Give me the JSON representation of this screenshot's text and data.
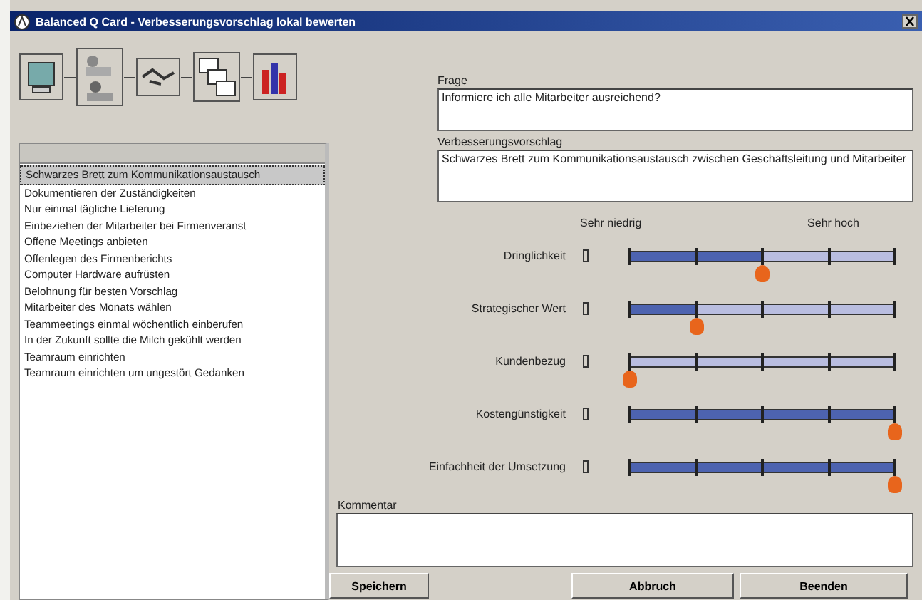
{
  "window": {
    "title": "Balanced Q Card - Verbesserungsvorschlag lokal bewerten"
  },
  "proposals": [
    {
      "label": "Schwarzes Brett zum Kommunikationsaustausch",
      "selected": true
    },
    {
      "label": "Dokumentieren der Zuständigkeiten",
      "selected": false
    },
    {
      "label": "Nur einmal tägliche Lieferung",
      "selected": false
    },
    {
      "label": "Einbeziehen der Mitarbeiter bei Firmenveranst",
      "selected": false
    },
    {
      "label": "Offene Meetings anbieten",
      "selected": false
    },
    {
      "label": "Offenlegen des Firmenberichts",
      "selected": false
    },
    {
      "label": "Computer Hardware aufrüsten",
      "selected": false
    },
    {
      "label": "Belohnung für besten Vorschlag",
      "selected": false
    },
    {
      "label": "Mitarbeiter des Monats wählen",
      "selected": false
    },
    {
      "label": "Teammeetings einmal wöchentlich einberufen",
      "selected": false
    },
    {
      "label": "In der Zukunft sollte die Milch gekühlt werden",
      "selected": false
    },
    {
      "label": "Teamraum einrichten",
      "selected": false
    },
    {
      "label": "Teamraum einrichten um ungestört Gedanken",
      "selected": false
    }
  ],
  "question": {
    "label": "Frage",
    "value": "Informiere ich alle Mitarbeiter ausreichend?"
  },
  "proposal": {
    "label": "Verbesserungsvorschlag",
    "value": "Schwarzes Brett zum Kommunikationsaustausch zwischen Geschäftsleitung und Mitarbeiter"
  },
  "scale": {
    "low": "Sehr niedrig",
    "high": "Sehr hoch"
  },
  "criteria": [
    {
      "label": "Dringlichkeit",
      "level": 0.5
    },
    {
      "label": "Strategischer Wert",
      "level": 0.25
    },
    {
      "label": "Kundenbezug",
      "level": 0
    },
    {
      "label": "Kostengünstigkeit",
      "level": 1
    },
    {
      "label": "Einfachheit der Umsetzung",
      "level": 1
    }
  ],
  "comment": {
    "label": "Kommentar"
  },
  "buttons": [
    "Speichern",
    "Abbruch",
    "Beenden"
  ]
}
